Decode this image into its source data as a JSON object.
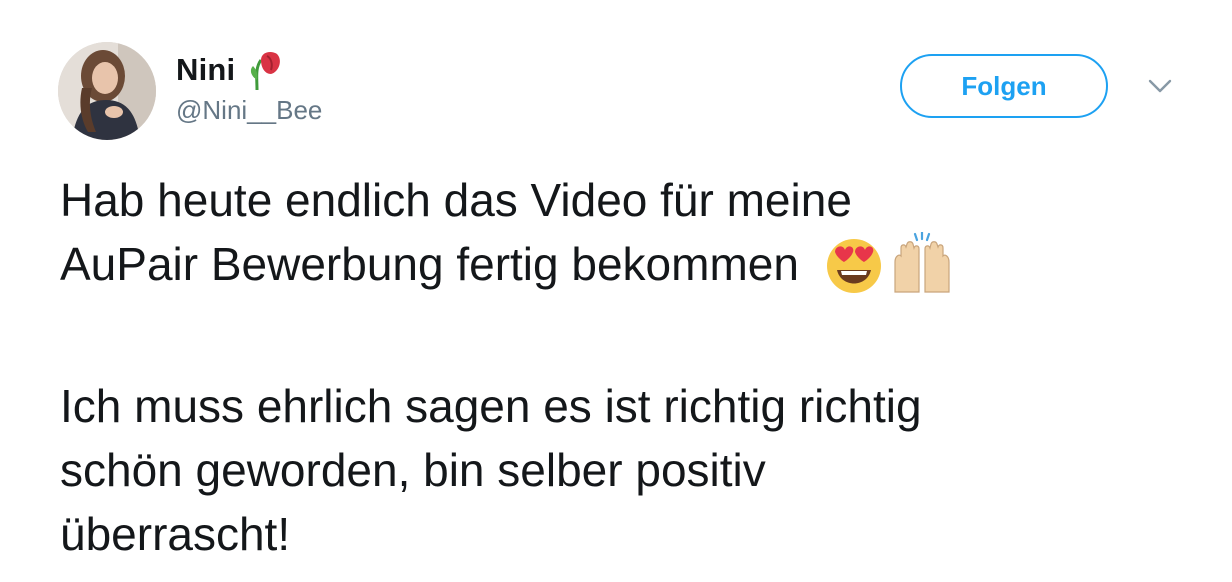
{
  "user": {
    "display_name": "Nini",
    "handle": "@Nini__Bee",
    "name_emoji": "wilted-flower-emoji",
    "avatar": "user-avatar-photo"
  },
  "actions": {
    "follow_label": "Folgen",
    "menu_icon": "chevron-down-icon"
  },
  "tweet": {
    "line1": "Hab heute endlich das Video für meine",
    "line2": "AuPair Bewerbung fertig bekommen",
    "line2_emojis": [
      "heart-eyes-emoji",
      "raising-hands-emoji"
    ],
    "line3": "Ich muss ehrlich sagen es ist richtig richtig",
    "line4": "schön geworden, bin selber positiv",
    "line5": "überrascht!"
  },
  "colors": {
    "text": "#14171a",
    "secondary": "#657786",
    "accent": "#1da1f2"
  }
}
